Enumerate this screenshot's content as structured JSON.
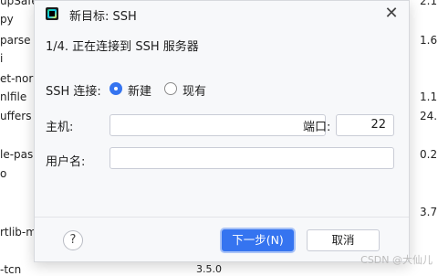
{
  "background": {
    "left_items": [
      "upSafe",
      "py",
      "parse",
      "i",
      "et-nor",
      "nlfile",
      "uffers",
      "le-pas",
      "o",
      "rtlib-m",
      "-tcn"
    ],
    "right_items": [
      "2.1",
      "1.6",
      "1.1",
      "24.",
      "0.2",
      "3.7"
    ],
    "bottom_version": "3.5.0"
  },
  "dialog": {
    "title": "新目标: SSH",
    "close_glyph": "✕",
    "step": "1/4. 正在连接到 SSH 服务器",
    "ssh_connection_label": "SSH 连接:",
    "options": [
      {
        "label": "新建",
        "selected": true
      },
      {
        "label": "现有",
        "selected": false
      }
    ],
    "host_label": "主机:",
    "host_value": "",
    "port_label": "端口:",
    "port_value": "22",
    "username_label": "用户名:",
    "username_value": "",
    "help_glyph": "?",
    "next_button": "下一步(N)",
    "cancel_button": "取消"
  },
  "watermark": "CSDN @大仙儿",
  "colors": {
    "accent": "#3574f0",
    "dialog_bg": "#f7f8fa",
    "field_border": "#c9ccd6"
  }
}
